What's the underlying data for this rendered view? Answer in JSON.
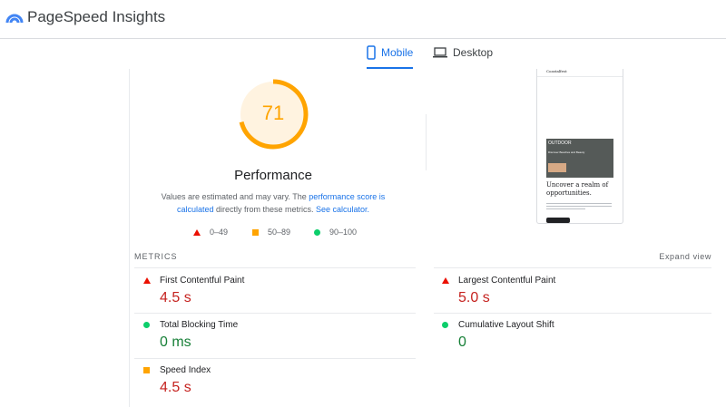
{
  "app": {
    "title": "PageSpeed Insights"
  },
  "tabs": [
    {
      "label": "Mobile",
      "active": true,
      "icon": "smartphone-icon"
    },
    {
      "label": "Desktop",
      "active": false,
      "icon": "laptop-icon"
    }
  ],
  "performance": {
    "score": "71",
    "score_fraction": 0.71,
    "title": "Performance",
    "disclaimer": {
      "part1": "Values are estimated and may vary. The ",
      "link1": "performance score is calculated",
      "part2": " directly from these metrics. ",
      "link2": "See calculator."
    },
    "legend": [
      {
        "range": "0–49",
        "icon": "red-triangle-icon",
        "color": "#eb0f00"
      },
      {
        "range": "50–89",
        "icon": "orange-square-icon",
        "color": "#ffa400"
      },
      {
        "range": "90–100",
        "icon": "green-circle-icon",
        "color": "#0cce6b"
      }
    ],
    "gauge_color": "#ffa400"
  },
  "screenshot": {
    "brand": "Coastalfest",
    "hero_tag": "OUTDOOR",
    "hero_sub": "Discover Beaches and Beauty",
    "heading": "Uncover a realm of opportunities."
  },
  "metrics": {
    "label": "METRICS",
    "expand_label": "Expand view",
    "items": [
      {
        "name": "First Contentful Paint",
        "value": "4.5 s",
        "status": "fail"
      },
      {
        "name": "Largest Contentful Paint",
        "value": "5.0 s",
        "status": "fail"
      },
      {
        "name": "Total Blocking Time",
        "value": "0 ms",
        "status": "pass"
      },
      {
        "name": "Cumulative Layout Shift",
        "value": "0",
        "status": "pass"
      },
      {
        "name": "Speed Index",
        "value": "4.5 s",
        "status": "average"
      }
    ]
  }
}
